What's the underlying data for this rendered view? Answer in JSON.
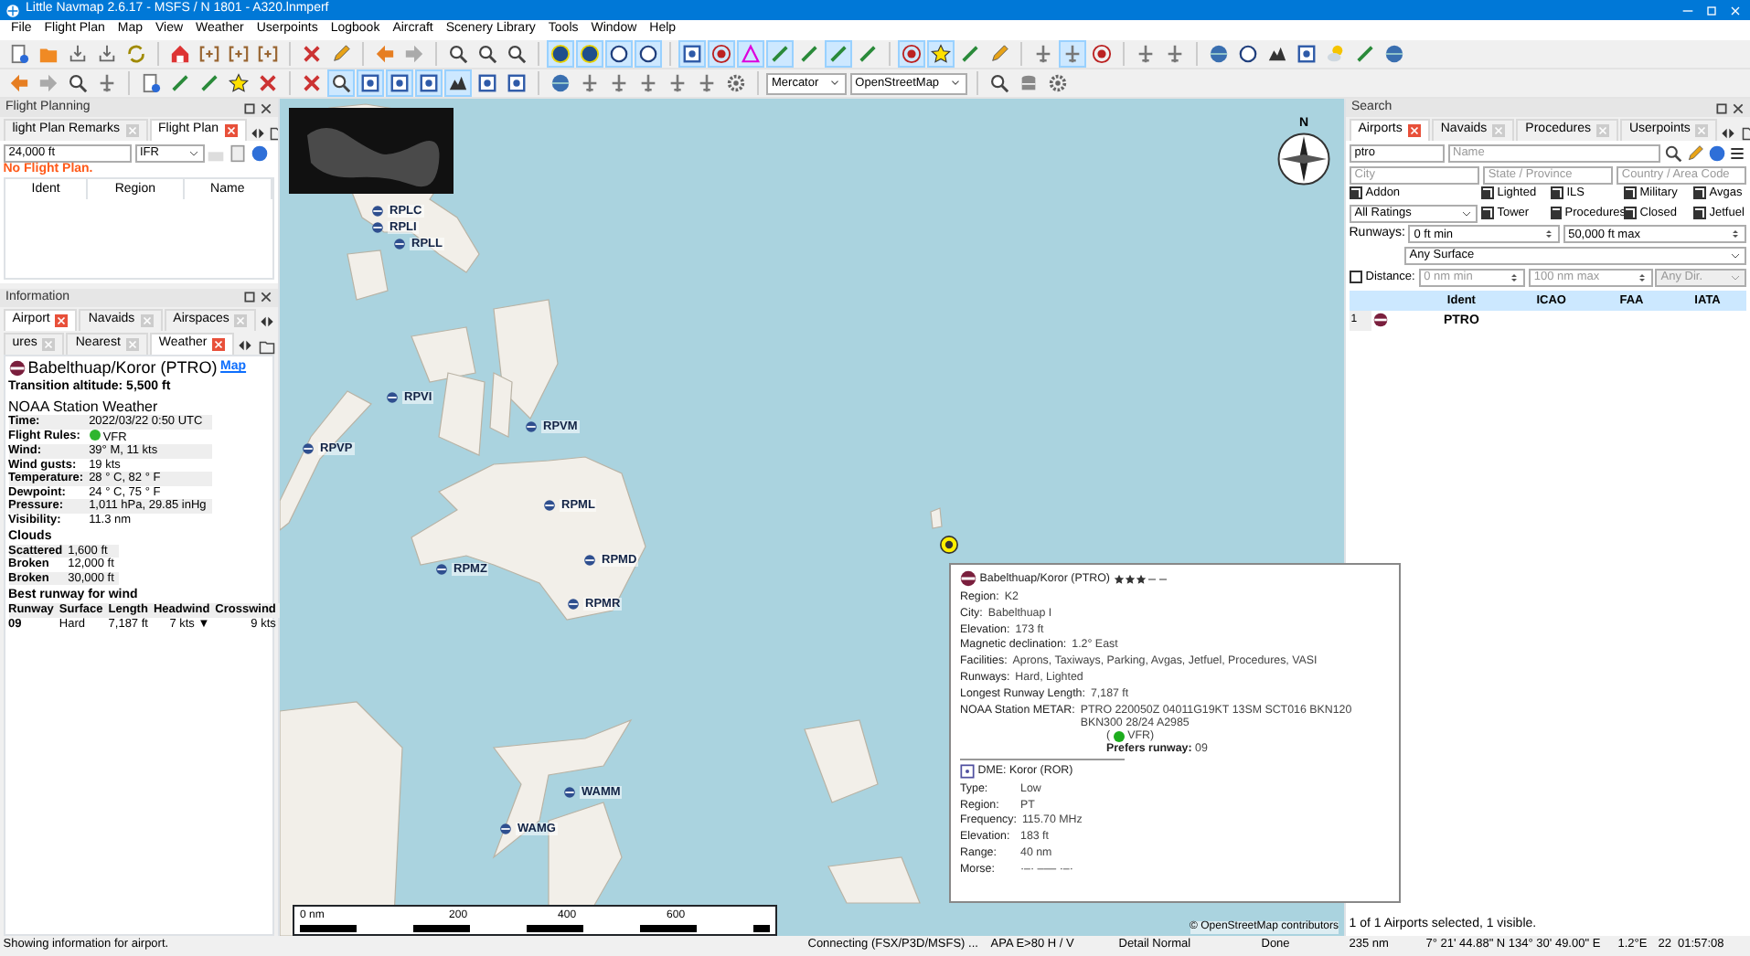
{
  "window": {
    "title": "Little Navmap 2.6.17 - MSFS / N 1801 - A320.lnmperf"
  },
  "menu": [
    "File",
    "Flight Plan",
    "Map",
    "View",
    "Weather",
    "Userpoints",
    "Logbook",
    "Aircraft",
    "Scenery Library",
    "Tools",
    "Window",
    "Help"
  ],
  "toolbar_rows": [
    [
      {
        "kind": "doc",
        "selected": false
      },
      {
        "kind": "folder",
        "selected": false
      },
      {
        "kind": "tray",
        "selected": false
      },
      {
        "kind": "tray",
        "selected": false
      },
      {
        "kind": "refresh",
        "selected": false
      },
      {
        "kind": "sep"
      },
      {
        "kind": "house",
        "selected": false
      },
      {
        "kind": "bracket",
        "selected": false
      },
      {
        "kind": "bracket",
        "selected": false
      },
      {
        "kind": "bracket",
        "selected": false
      },
      {
        "kind": "sep"
      },
      {
        "kind": "cross",
        "selected": false
      },
      {
        "kind": "pencil",
        "selected": false
      },
      {
        "kind": "sep"
      },
      {
        "kind": "left",
        "selected": false
      },
      {
        "kind": "right",
        "selected": false
      },
      {
        "kind": "sep"
      },
      {
        "kind": "search",
        "selected": false
      },
      {
        "kind": "search",
        "selected": false
      },
      {
        "kind": "search",
        "selected": false
      },
      {
        "kind": "sep"
      },
      {
        "kind": "disc",
        "selected": true
      },
      {
        "kind": "disc",
        "selected": true
      },
      {
        "kind": "ring",
        "selected": true
      },
      {
        "kind": "ring",
        "selected": true
      },
      {
        "kind": "sep"
      },
      {
        "kind": "square",
        "selected": true
      },
      {
        "kind": "target",
        "selected": true
      },
      {
        "kind": "triangle",
        "selected": true
      },
      {
        "kind": "line",
        "selected": true
      },
      {
        "kind": "line",
        "selected": false
      },
      {
        "kind": "line",
        "selected": true
      },
      {
        "kind": "line",
        "selected": false
      },
      {
        "kind": "sep"
      },
      {
        "kind": "target",
        "selected": true
      },
      {
        "kind": "star",
        "selected": true
      },
      {
        "kind": "line",
        "selected": false
      },
      {
        "kind": "pencil",
        "selected": false
      },
      {
        "kind": "sep"
      },
      {
        "kind": "plane",
        "selected": false
      },
      {
        "kind": "plane",
        "selected": true
      },
      {
        "kind": "target",
        "selected": false
      },
      {
        "kind": "sep"
      },
      {
        "kind": "plane",
        "selected": false
      },
      {
        "kind": "plane",
        "selected": false
      },
      {
        "kind": "sep"
      },
      {
        "kind": "globe",
        "selected": false
      },
      {
        "kind": "ring",
        "selected": false
      },
      {
        "kind": "mountain",
        "selected": false
      },
      {
        "kind": "square",
        "selected": false
      },
      {
        "kind": "cloud",
        "selected": false
      },
      {
        "kind": "line",
        "selected": false
      },
      {
        "kind": "globe",
        "selected": false
      }
    ],
    [
      {
        "kind": "left",
        "selected": false
      },
      {
        "kind": "right",
        "selected": false
      },
      {
        "kind": "search",
        "selected": false
      },
      {
        "kind": "plane",
        "selected": false
      },
      {
        "kind": "sep"
      },
      {
        "kind": "doc",
        "selected": false
      },
      {
        "kind": "line",
        "selected": false
      },
      {
        "kind": "line",
        "selected": false
      },
      {
        "kind": "star",
        "selected": false
      },
      {
        "kind": "cross",
        "selected": false
      },
      {
        "kind": "sep"
      },
      {
        "kind": "cross",
        "selected": false
      },
      {
        "kind": "search",
        "selected": true
      },
      {
        "kind": "square",
        "selected": true
      },
      {
        "kind": "square",
        "selected": true
      },
      {
        "kind": "square",
        "selected": true
      },
      {
        "kind": "mountain",
        "selected": true
      },
      {
        "kind": "square",
        "selected": false
      },
      {
        "kind": "square",
        "selected": false
      },
      {
        "kind": "sep"
      },
      {
        "kind": "globe",
        "selected": false
      },
      {
        "kind": "plane",
        "selected": false
      },
      {
        "kind": "plane",
        "selected": false
      },
      {
        "kind": "plane",
        "selected": false
      },
      {
        "kind": "plane",
        "selected": false
      },
      {
        "kind": "plane",
        "selected": false
      },
      {
        "kind": "gear",
        "selected": false
      },
      {
        "kind": "sep"
      },
      {
        "kind": "select",
        "value": "Mercator"
      },
      {
        "kind": "select",
        "value": "OpenStreetMap"
      },
      {
        "kind": "sep"
      },
      {
        "kind": "search",
        "selected": false
      },
      {
        "kind": "db",
        "selected": false
      },
      {
        "kind": "gear",
        "selected": false
      }
    ]
  ],
  "flight_planning": {
    "title": "Flight Planning",
    "tabs": [
      {
        "label": "light Plan Remarks",
        "selected": false
      },
      {
        "label": "Flight Plan",
        "selected": true
      }
    ],
    "altitude": "24,000 ft",
    "rules": "IFR",
    "message": "No Flight Plan.",
    "columns": [
      "Ident",
      "Region",
      "Name"
    ]
  },
  "information": {
    "title": "Information",
    "tabs": [
      {
        "label": "Airport",
        "selected": true
      },
      {
        "label": "Navaids",
        "selected": false
      },
      {
        "label": "Airspaces",
        "selected": false
      }
    ],
    "subtabs": [
      {
        "label": "ures",
        "selected": false
      },
      {
        "label": "Nearest",
        "selected": false
      },
      {
        "label": "Weather",
        "selected": true
      }
    ],
    "name": "Babelthuap/Koror (PTRO)",
    "map_link": "Map",
    "transition": "Transition altitude: 5,500 ft",
    "weather_title": "NOAA Station Weather",
    "weather": [
      {
        "label": "Time:",
        "value": "2022/03/22 0:50 UTC"
      },
      {
        "label": "Flight Rules:",
        "value": "VFR",
        "color": "#2fb52f"
      },
      {
        "label": "Wind:",
        "value": "39°  M, 11 kts"
      },
      {
        "label": "Wind gusts:",
        "value": "19 kts"
      },
      {
        "label": "Temperature:",
        "value": "28 ° C, 82 ° F"
      },
      {
        "label": "Dewpoint:",
        "value": "24 ° C, 75 ° F"
      },
      {
        "label": "Pressure:",
        "value": "1,011 hPa, 29.85 inHg"
      },
      {
        "label": "Visibility:",
        "value": "11.3 nm"
      }
    ],
    "clouds_title": "Clouds",
    "clouds": [
      {
        "label": "Scattered",
        "value": "1,600 ft"
      },
      {
        "label": "Broken",
        "value": "12,000 ft"
      },
      {
        "label": "Broken",
        "value": "30,000 ft"
      }
    ],
    "runway_title": "Best runway for wind",
    "runway_columns": [
      "Runway",
      "Surface",
      "Length",
      "Headwind",
      "Crosswind"
    ],
    "runway_rows": [
      [
        "09",
        "Hard",
        "7,187 ft",
        "7 kts ▼",
        "9 kts"
      ]
    ]
  },
  "map": {
    "airports": [
      {
        "ident": "RPLC"
      },
      {
        "ident": "RPLI"
      },
      {
        "ident": "RPLL"
      },
      {
        "ident": "RPVP"
      },
      {
        "ident": "RPVI"
      },
      {
        "ident": "RPVM"
      },
      {
        "ident": "RPML"
      },
      {
        "ident": "RPMD"
      },
      {
        "ident": "RPMZ"
      },
      {
        "ident": "RPMR"
      },
      {
        "ident": "WAMM"
      },
      {
        "ident": "WAMG"
      }
    ],
    "compass": "N",
    "scale": [
      "0 nm",
      "200",
      "400",
      "600"
    ],
    "attribution": "© OpenStreetMap contributors",
    "tooltip": {
      "title": "Babelthuap/Koror (PTRO)",
      "stars": 3,
      "rows": [
        {
          "label": "Region:",
          "value": "K2"
        },
        {
          "label": "City:",
          "value": "Babelthuap I"
        },
        {
          "label": "Elevation:",
          "value": "173 ft"
        },
        {
          "label": "Magnetic declination:",
          "value": "1.2° East"
        },
        {
          "label": "Facilities:",
          "value": "Aprons, Taxiways, Parking, Avgas, Jetfuel, Procedures, VASI"
        },
        {
          "label": "Runways:",
          "value": "Hard, Lighted"
        },
        {
          "label": "Longest Runway Length:",
          "value": "7,187 ft"
        },
        {
          "label": "NOAA Station METAR:",
          "value": "PTRO 220050Z 04011G19KT 13SM SCT016 BKN120 BKN300 28/24 A2985"
        }
      ],
      "flight_rule": [
        "(",
        "VFR)"
      ],
      "prefers": {
        "label": "Prefers runway:",
        "value": "09"
      },
      "dme_title": "DME: Koror (ROR)",
      "dme_rows": [
        {
          "label": "Type:",
          "value": "Low"
        },
        {
          "label": "Region:",
          "value": "PT"
        },
        {
          "label": "Frequency:",
          "value": "115.70 MHz"
        },
        {
          "label": "Elevation:",
          "value": "183 ft"
        },
        {
          "label": "Range:",
          "value": "40 nm"
        },
        {
          "label": "Morse:",
          "value": "·–·  –––  ·–·"
        }
      ]
    }
  },
  "search": {
    "title": "Search",
    "tabs": [
      {
        "label": "Airports",
        "selected": true
      },
      {
        "label": "Navaids",
        "selected": false
      },
      {
        "label": "Procedures",
        "selected": false
      },
      {
        "label": "Userpoints",
        "selected": false
      }
    ],
    "ident": "ptro",
    "name_placeholder": "Name",
    "city_placeholder": "City",
    "state_placeholder": "State / Province",
    "country_placeholder": "Country / Area Code",
    "filters": [
      {
        "label": "Addon",
        "checked": true
      },
      {
        "label": "Lighted",
        "checked": true
      },
      {
        "label": "ILS",
        "checked": true
      },
      {
        "label": "Military",
        "checked": true
      },
      {
        "label": "Avgas",
        "checked": true
      },
      {
        "kind": "select",
        "value": "All Ratings"
      },
      {
        "label": "Tower",
        "checked": true
      },
      {
        "label": "Procedures",
        "checked": true
      },
      {
        "label": "Closed",
        "checked": true
      },
      {
        "label": "Jetfuel",
        "checked": true
      }
    ],
    "runways_label": "Runways:",
    "runway_min": "0 ft min",
    "runway_max": "50,000 ft max",
    "surface": "Any Surface",
    "distance": {
      "label": "Distance:",
      "checked": false,
      "min": "0 nm min",
      "max": "100 nm max",
      "direction": "Any Dir."
    },
    "columns": [
      "Ident",
      "ICAO",
      "FAA",
      "IATA"
    ],
    "rows": [
      {
        "number": "1",
        "ident": "PTRO",
        "selected": false
      }
    ],
    "footer": "1 of 1 Airports selected, 1 visible."
  },
  "status_bar": [
    "Showing information for airport.",
    "Connecting (FSX/P3D/MSFS) ...",
    "APA E>80 H / V",
    "Detail Normal",
    "Done",
    "235 nm",
    "7° 21' 44.88\" N 134° 30' 49.00\" E",
    "1.2°E",
    "22",
    "01:57:08"
  ]
}
